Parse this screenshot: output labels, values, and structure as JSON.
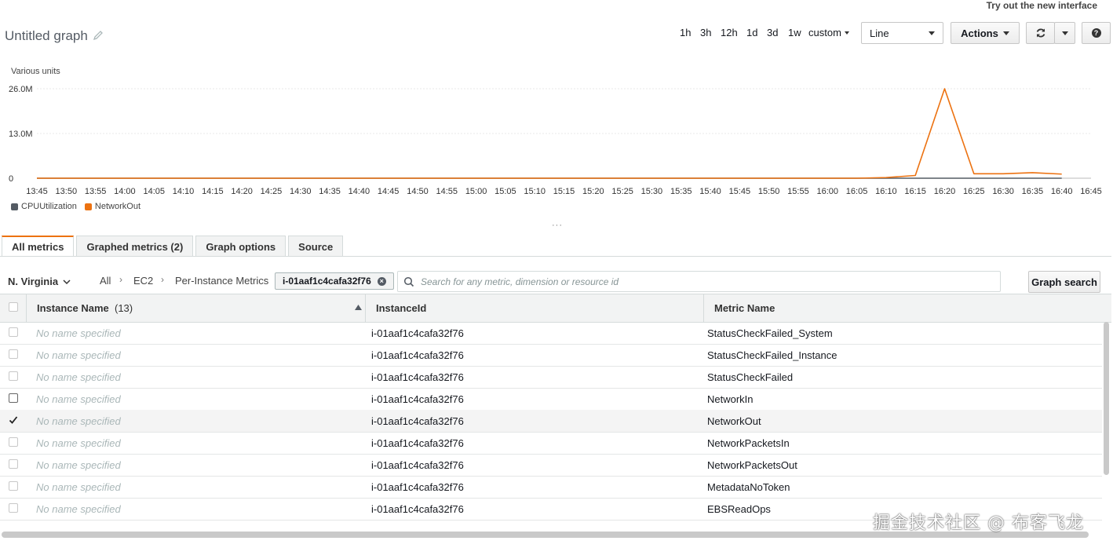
{
  "header": {
    "try_link": "Try out the new interface",
    "title": "Untitled graph",
    "time_ranges": [
      "1h",
      "3h",
      "12h",
      "1d",
      "3d",
      "1w",
      "custom"
    ],
    "view_type": "Line",
    "actions_label": "Actions"
  },
  "chart_data": {
    "type": "line",
    "ylabel": "Various units",
    "y_ticks": [
      "26.0M",
      "13.0M",
      "0"
    ],
    "ylim": [
      0,
      26000000
    ],
    "x_ticks": [
      "13:45",
      "13:50",
      "13:55",
      "14:00",
      "14:05",
      "14:10",
      "14:15",
      "14:20",
      "14:25",
      "14:30",
      "14:35",
      "14:40",
      "14:45",
      "14:50",
      "14:55",
      "15:00",
      "15:05",
      "15:10",
      "15:15",
      "15:20",
      "15:25",
      "15:30",
      "15:35",
      "15:40",
      "15:45",
      "15:50",
      "15:55",
      "16:00",
      "16:05",
      "16:10",
      "16:15",
      "16:20",
      "16:25",
      "16:30",
      "16:35",
      "16:40",
      "16:45"
    ],
    "legend": [
      "CPUUtilization",
      "NetworkOut"
    ],
    "series": [
      {
        "name": "CPUUtilization",
        "color": "#545b64",
        "x": [
          "13:45",
          "16:40"
        ],
        "y": [
          0,
          0
        ]
      },
      {
        "name": "NetworkOut",
        "color": "#ec7211",
        "x": [
          "13:45",
          "16:05",
          "16:10",
          "16:15",
          "16:20",
          "16:25",
          "16:30",
          "16:35",
          "16:40"
        ],
        "y": [
          0,
          0,
          200000,
          800000,
          26000000,
          1300000,
          1300000,
          1600000,
          1200000
        ]
      }
    ]
  },
  "tabs": [
    "All metrics",
    "Graphed metrics (2)",
    "Graph options",
    "Source"
  ],
  "search": {
    "region": "N. Virginia",
    "breadcrumbs": [
      "All",
      "EC2",
      "Per-Instance Metrics"
    ],
    "token": "i-01aaf1c4cafa32f76",
    "placeholder": "Search for any metric, dimension or resource id",
    "graph_search_label": "Graph search"
  },
  "table": {
    "columns": [
      "Instance Name",
      "(13)",
      "InstanceId",
      "Metric Name"
    ],
    "rows": [
      {
        "name": "No name specified",
        "instance": "i-01aaf1c4cafa32f76",
        "metric": "StatusCheckFailed_System"
      },
      {
        "name": "No name specified",
        "instance": "i-01aaf1c4cafa32f76",
        "metric": "StatusCheckFailed_Instance"
      },
      {
        "name": "No name specified",
        "instance": "i-01aaf1c4cafa32f76",
        "metric": "StatusCheckFailed"
      },
      {
        "name": "No name specified",
        "instance": "i-01aaf1c4cafa32f76",
        "metric": "NetworkIn"
      },
      {
        "name": "No name specified",
        "instance": "i-01aaf1c4cafa32f76",
        "metric": "NetworkOut"
      },
      {
        "name": "No name specified",
        "instance": "i-01aaf1c4cafa32f76",
        "metric": "NetworkPacketsIn"
      },
      {
        "name": "No name specified",
        "instance": "i-01aaf1c4cafa32f76",
        "metric": "NetworkPacketsOut"
      },
      {
        "name": "No name specified",
        "instance": "i-01aaf1c4cafa32f76",
        "metric": "MetadataNoToken"
      },
      {
        "name": "No name specified",
        "instance": "i-01aaf1c4cafa32f76",
        "metric": "EBSReadOps"
      }
    ],
    "selected_metric": "NetworkOut"
  },
  "watermark": "掘金技术社区 @ 布客飞龙"
}
